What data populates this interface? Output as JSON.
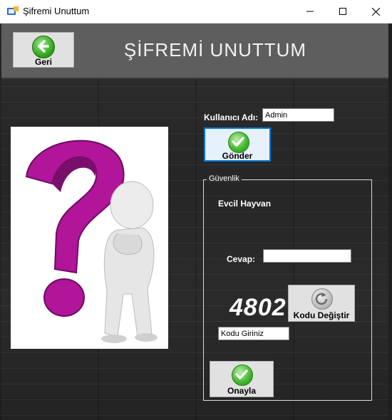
{
  "window": {
    "title": "Şifremi Unuttum",
    "minimize": "—",
    "maximize": "☐",
    "close": "✕"
  },
  "header": {
    "title": "ŞİFREMİ UNUTTUM",
    "back_label": "Geri",
    "back_icon": "arrow-left-icon"
  },
  "form": {
    "username_label": "Kullanıcı Adı:",
    "username_value": "Admin",
    "send_label": "Gönder",
    "send_icon": "check-icon"
  },
  "security": {
    "legend": "Güvenlik",
    "question": "Evcil Hayvan",
    "answer_label": "Cevap:",
    "answer_value": "",
    "captcha_code": "4802",
    "change_code_label": "Kodu Değiştir",
    "change_code_icon": "refresh-icon",
    "code_input_value": "Kodu Giriniz",
    "confirm_label": "Onayla",
    "confirm_icon": "check-icon"
  },
  "colors": {
    "accent": "#0078d7",
    "question_mark": "#b0159a",
    "check_green": "#3fb52a"
  }
}
